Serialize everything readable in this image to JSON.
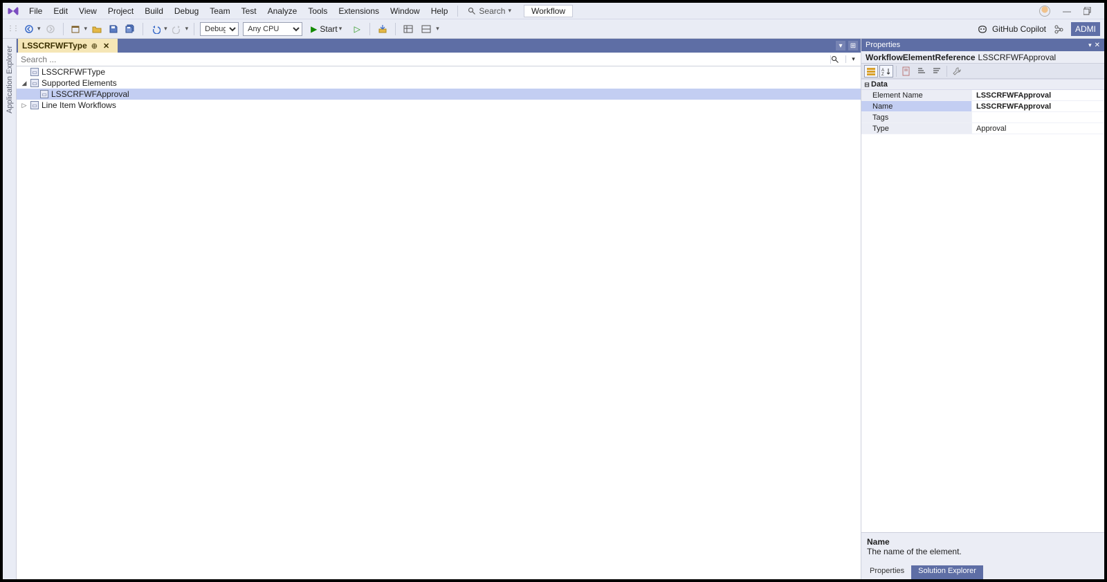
{
  "menu": {
    "items": [
      "File",
      "Edit",
      "View",
      "Project",
      "Build",
      "Debug",
      "Team",
      "Test",
      "Analyze",
      "Tools",
      "Extensions",
      "Window",
      "Help"
    ],
    "search_label": "Search",
    "workflow_tab": "Workflow"
  },
  "toolbar": {
    "config": "Debug",
    "platform": "Any CPU",
    "start_label": "Start",
    "copilot_label": "GitHub Copilot",
    "admi_label": "ADMI"
  },
  "side_tool": {
    "app_explorer": "Application Explorer"
  },
  "document": {
    "tab_title": "LSSCRFWFType",
    "search_placeholder": "Search ..."
  },
  "tree": {
    "root": "LSSCRFWFType",
    "supported_elements": "Supported Elements",
    "approval_node": "LSSCRFWFApproval",
    "line_item_workflows": "Line Item Workflows"
  },
  "properties": {
    "panel_title": "Properties",
    "obj_type": "WorkflowElementReference",
    "obj_name": "LSSCRFWFApproval",
    "category": "Data",
    "rows": [
      {
        "name": "Element Name",
        "value": "LSSCRFWFApproval",
        "bold": true,
        "sel": false
      },
      {
        "name": "Name",
        "value": "LSSCRFWFApproval",
        "bold": true,
        "sel": true
      },
      {
        "name": "Tags",
        "value": "",
        "bold": false,
        "sel": false
      },
      {
        "name": "Type",
        "value": "Approval",
        "bold": false,
        "sel": false
      }
    ],
    "desc_title": "Name",
    "desc_body": "The name of the element.",
    "bottom_tabs": [
      "Properties",
      "Solution Explorer"
    ]
  }
}
